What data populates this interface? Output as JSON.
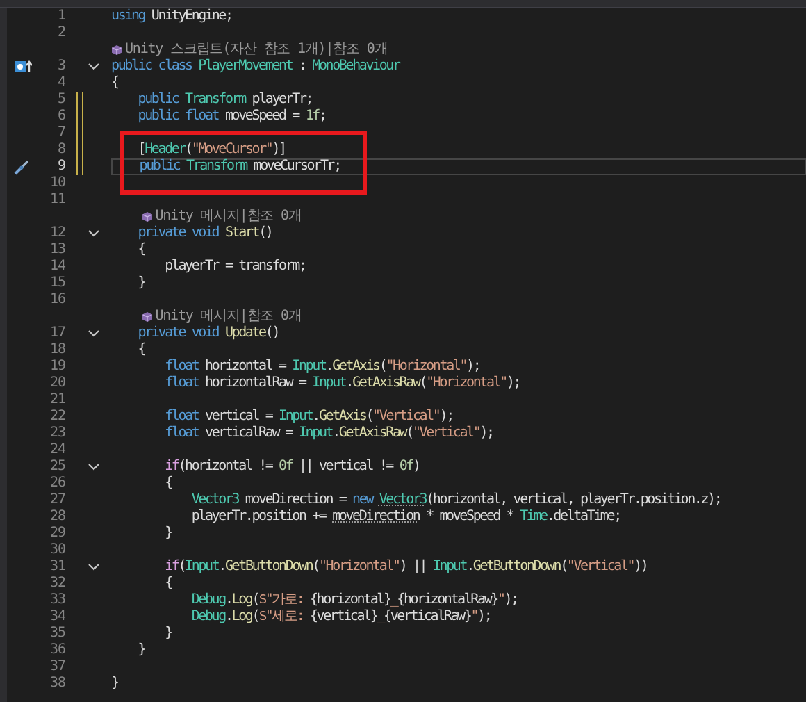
{
  "editor": {
    "rows": [
      {
        "kind": "code",
        "number": "1",
        "tokens": [
          {
            "kind": "k",
            "text": "using"
          },
          {
            "kind": "p",
            "text": " UnityEngine;"
          }
        ]
      },
      {
        "kind": "code",
        "number": "2"
      },
      {
        "kind": "lens",
        "text": "Unity 스크립트(자산 참조 1개)|참조 0개"
      },
      {
        "kind": "code",
        "number": "3",
        "glyph": {
          "kind": "implements"
        },
        "expanded": true,
        "tokens": [
          {
            "kind": "k",
            "text": "public class "
          },
          {
            "kind": "t",
            "text": "PlayerMovement"
          },
          {
            "kind": "p",
            "text": " : "
          },
          {
            "kind": "t",
            "text": "MonoBehaviour"
          }
        ]
      },
      {
        "kind": "code",
        "number": "4",
        "tokens": [
          {
            "kind": "p",
            "text": "{"
          }
        ]
      },
      {
        "kind": "code",
        "number": "5",
        "modified": true,
        "tokens": [
          {
            "kind": "k",
            "text": "    public "
          },
          {
            "kind": "t",
            "text": "Transform"
          },
          {
            "kind": "p",
            "text": " playerTr;"
          }
        ]
      },
      {
        "kind": "code",
        "number": "6",
        "modified": true,
        "tokens": [
          {
            "kind": "k",
            "text": "    public float"
          },
          {
            "kind": "p",
            "text": " moveSpeed = "
          },
          {
            "kind": "n",
            "text": "1f"
          },
          {
            "kind": "p",
            "text": ";"
          }
        ]
      },
      {
        "kind": "code",
        "number": "7",
        "modified": true
      },
      {
        "kind": "code",
        "number": "8",
        "modified": true,
        "tokens": [
          {
            "kind": "p",
            "text": "    ["
          },
          {
            "kind": "t",
            "text": "Header"
          },
          {
            "kind": "p",
            "text": "("
          },
          {
            "kind": "s",
            "text": "\"MoveCursor\""
          },
          {
            "kind": "p",
            "text": ")]"
          }
        ]
      },
      {
        "kind": "code",
        "number": "9",
        "modified": true,
        "current": true,
        "glyph": {
          "kind": "quick-action"
        },
        "tokens": [
          {
            "kind": "k",
            "text": "    public "
          },
          {
            "kind": "t",
            "text": "Transform"
          },
          {
            "kind": "p",
            "text": " moveCursorTr;"
          }
        ]
      },
      {
        "kind": "code",
        "number": "10"
      },
      {
        "kind": "code",
        "number": "11"
      },
      {
        "kind": "lens",
        "text": "    Unity 메시지|참조 0개"
      },
      {
        "kind": "code",
        "number": "12",
        "expanded": true,
        "tokens": [
          {
            "kind": "k",
            "text": "    private void "
          },
          {
            "kind": "m",
            "text": "Start"
          },
          {
            "kind": "p",
            "text": "()"
          }
        ]
      },
      {
        "kind": "code",
        "number": "13",
        "tokens": [
          {
            "kind": "p",
            "text": "    {"
          }
        ]
      },
      {
        "kind": "code",
        "number": "14",
        "tokens": [
          {
            "kind": "p",
            "text": "        playerTr = transform;"
          }
        ]
      },
      {
        "kind": "code",
        "number": "15",
        "tokens": [
          {
            "kind": "p",
            "text": "    }"
          }
        ]
      },
      {
        "kind": "code",
        "number": "16"
      },
      {
        "kind": "lens",
        "text": "    Unity 메시지|참조 0개"
      },
      {
        "kind": "code",
        "number": "17",
        "expanded": true,
        "tokens": [
          {
            "kind": "k",
            "text": "    private void "
          },
          {
            "kind": "m",
            "text": "Update"
          },
          {
            "kind": "p",
            "text": "()"
          }
        ]
      },
      {
        "kind": "code",
        "number": "18",
        "tokens": [
          {
            "kind": "p",
            "text": "    {"
          }
        ]
      },
      {
        "kind": "code",
        "number": "19",
        "tokens": [
          {
            "kind": "k",
            "text": "        float"
          },
          {
            "kind": "p",
            "text": " horizontal = "
          },
          {
            "kind": "t",
            "text": "Input"
          },
          {
            "kind": "p",
            "text": "."
          },
          {
            "kind": "m",
            "text": "GetAxis"
          },
          {
            "kind": "p",
            "text": "("
          },
          {
            "kind": "s",
            "text": "\"Horizontal\""
          },
          {
            "kind": "p",
            "text": ");"
          }
        ]
      },
      {
        "kind": "code",
        "number": "20",
        "tokens": [
          {
            "kind": "k",
            "text": "        float"
          },
          {
            "kind": "p",
            "text": " horizontalRaw = "
          },
          {
            "kind": "t",
            "text": "Input"
          },
          {
            "kind": "p",
            "text": "."
          },
          {
            "kind": "m",
            "text": "GetAxisRaw"
          },
          {
            "kind": "p",
            "text": "("
          },
          {
            "kind": "s",
            "text": "\"Horizontal\""
          },
          {
            "kind": "p",
            "text": ");"
          }
        ]
      },
      {
        "kind": "code",
        "number": "21"
      },
      {
        "kind": "code",
        "number": "22",
        "tokens": [
          {
            "kind": "k",
            "text": "        float"
          },
          {
            "kind": "p",
            "text": " vertical = "
          },
          {
            "kind": "t",
            "text": "Input"
          },
          {
            "kind": "p",
            "text": "."
          },
          {
            "kind": "m",
            "text": "GetAxis"
          },
          {
            "kind": "p",
            "text": "("
          },
          {
            "kind": "s",
            "text": "\"Vertical\""
          },
          {
            "kind": "p",
            "text": ");"
          }
        ]
      },
      {
        "kind": "code",
        "number": "23",
        "tokens": [
          {
            "kind": "k",
            "text": "        float"
          },
          {
            "kind": "p",
            "text": " verticalRaw = "
          },
          {
            "kind": "t",
            "text": "Input"
          },
          {
            "kind": "p",
            "text": "."
          },
          {
            "kind": "m",
            "text": "GetAxisRaw"
          },
          {
            "kind": "p",
            "text": "("
          },
          {
            "kind": "s",
            "text": "\"Vertical\""
          },
          {
            "kind": "p",
            "text": ");"
          }
        ]
      },
      {
        "kind": "code",
        "number": "24"
      },
      {
        "kind": "code",
        "number": "25",
        "expanded": true,
        "tokens": [
          {
            "kind": "c",
            "text": "        if"
          },
          {
            "kind": "p",
            "text": "(horizontal != "
          },
          {
            "kind": "n",
            "text": "0f"
          },
          {
            "kind": "p",
            "text": " || vertical != "
          },
          {
            "kind": "n",
            "text": "0f"
          },
          {
            "kind": "p",
            "text": ")"
          }
        ]
      },
      {
        "kind": "code",
        "number": "26",
        "tokens": [
          {
            "kind": "p",
            "text": "        {"
          }
        ]
      },
      {
        "kind": "code",
        "number": "27",
        "tokens": [
          {
            "kind": "t",
            "text": "            Vector3"
          },
          {
            "kind": "p",
            "text": " moveDirection = "
          },
          {
            "kind": "k",
            "text": "new "
          },
          {
            "kind": "th",
            "text": "Vector3"
          },
          {
            "kind": "p",
            "text": "(horizontal, vertical, playerTr.position.z);"
          }
        ]
      },
      {
        "kind": "code",
        "number": "28",
        "tokens": [
          {
            "kind": "p",
            "text": "            playerTr.position += "
          },
          {
            "kind": "ph",
            "text": "moveDirection"
          },
          {
            "kind": "p",
            "text": " * moveSpeed * "
          },
          {
            "kind": "t",
            "text": "Time"
          },
          {
            "kind": "p",
            "text": ".deltaTime;"
          }
        ]
      },
      {
        "kind": "code",
        "number": "29",
        "tokens": [
          {
            "kind": "p",
            "text": "        }"
          }
        ]
      },
      {
        "kind": "code",
        "number": "30"
      },
      {
        "kind": "code",
        "number": "31",
        "expanded": true,
        "tokens": [
          {
            "kind": "c",
            "text": "        if"
          },
          {
            "kind": "p",
            "text": "("
          },
          {
            "kind": "t",
            "text": "Input"
          },
          {
            "kind": "p",
            "text": "."
          },
          {
            "kind": "m",
            "text": "GetButtonDown"
          },
          {
            "kind": "p",
            "text": "("
          },
          {
            "kind": "s",
            "text": "\"Horizontal\""
          },
          {
            "kind": "p",
            "text": ") || "
          },
          {
            "kind": "t",
            "text": "Input"
          },
          {
            "kind": "p",
            "text": "."
          },
          {
            "kind": "m",
            "text": "GetButtonDown"
          },
          {
            "kind": "p",
            "text": "("
          },
          {
            "kind": "s",
            "text": "\"Vertical\""
          },
          {
            "kind": "p",
            "text": "))"
          }
        ]
      },
      {
        "kind": "code",
        "number": "32",
        "tokens": [
          {
            "kind": "p",
            "text": "        {"
          }
        ]
      },
      {
        "kind": "code",
        "number": "33",
        "tokens": [
          {
            "kind": "t",
            "text": "            Debug"
          },
          {
            "kind": "p",
            "text": "."
          },
          {
            "kind": "m",
            "text": "Log"
          },
          {
            "kind": "p",
            "text": "("
          },
          {
            "kind": "s",
            "text": "$\"가로: "
          },
          {
            "kind": "p",
            "text": "{horizontal}"
          },
          {
            "kind": "s",
            "text": "_"
          },
          {
            "kind": "p",
            "text": "{horizontalRaw}"
          },
          {
            "kind": "s",
            "text": "\""
          },
          {
            "kind": "p",
            "text": ");"
          }
        ]
      },
      {
        "kind": "code",
        "number": "34",
        "tokens": [
          {
            "kind": "t",
            "text": "            Debug"
          },
          {
            "kind": "p",
            "text": "."
          },
          {
            "kind": "m",
            "text": "Log"
          },
          {
            "kind": "p",
            "text": "("
          },
          {
            "kind": "s",
            "text": "$\"세로: "
          },
          {
            "kind": "p",
            "text": "{vertical}"
          },
          {
            "kind": "s",
            "text": "_"
          },
          {
            "kind": "p",
            "text": "{verticalRaw}"
          },
          {
            "kind": "s",
            "text": "\""
          },
          {
            "kind": "p",
            "text": ");"
          }
        ]
      },
      {
        "kind": "code",
        "number": "35",
        "tokens": [
          {
            "kind": "p",
            "text": "        }"
          }
        ]
      },
      {
        "kind": "code",
        "number": "36",
        "tokens": [
          {
            "kind": "p",
            "text": "    }"
          }
        ]
      },
      {
        "kind": "code",
        "number": "37"
      },
      {
        "kind": "code",
        "number": "38",
        "tokens": [
          {
            "kind": "p",
            "text": "}"
          }
        ]
      }
    ]
  }
}
